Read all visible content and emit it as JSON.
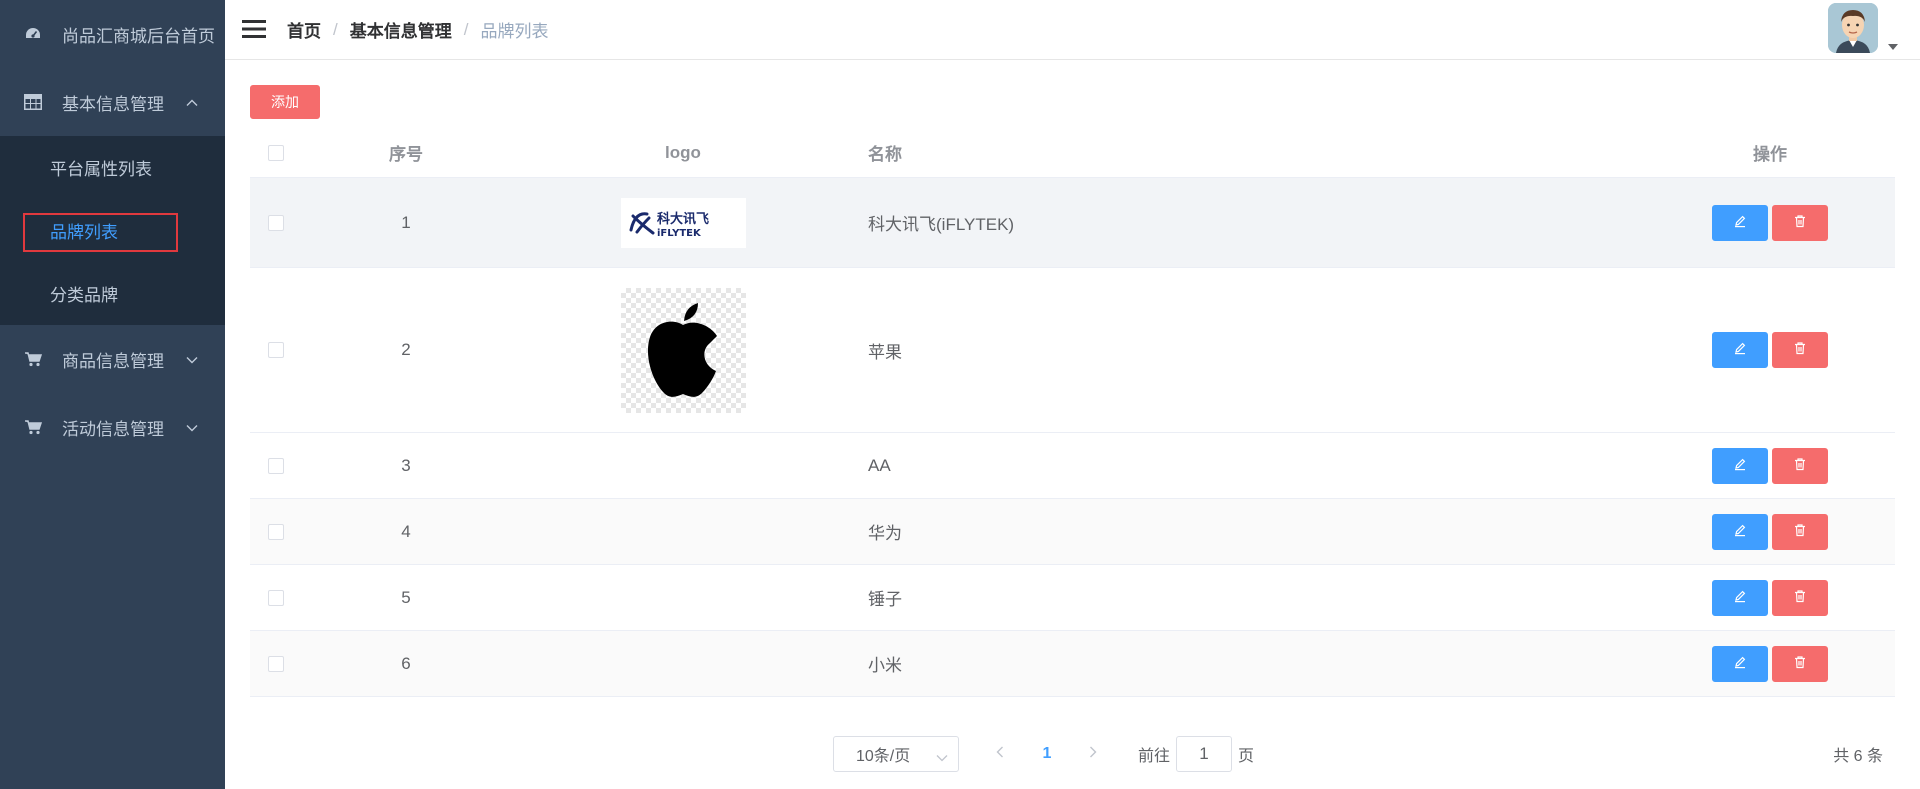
{
  "sidebar": {
    "home": "尚品汇商城后台首页",
    "groups": [
      {
        "label": "基本信息管理",
        "items": [
          "平台属性列表",
          "品牌列表",
          "分类品牌"
        ]
      },
      {
        "label": "商品信息管理"
      },
      {
        "label": "活动信息管理"
      }
    ]
  },
  "header": {
    "breadcrumb": [
      "首页",
      "基本信息管理",
      "品牌列表"
    ],
    "separator": "/"
  },
  "toolbar": {
    "add_label": "添加"
  },
  "table": {
    "columns": [
      "序号",
      "logo",
      "名称",
      "操作"
    ],
    "rows": [
      {
        "index": "1",
        "name": "科大讯飞(iFLYTEK)",
        "logo": "iflytek-logo"
      },
      {
        "index": "2",
        "name": "苹果",
        "logo": "apple-logo"
      },
      {
        "index": "3",
        "name": "AA",
        "logo": ""
      },
      {
        "index": "4",
        "name": "华为",
        "logo": ""
      },
      {
        "index": "5",
        "name": "锤子",
        "logo": ""
      },
      {
        "index": "6",
        "name": "小米",
        "logo": ""
      }
    ],
    "logo_text": {
      "iflytek_cn": "科大讯飞",
      "iflytek_en": "iFLYTEK"
    }
  },
  "pagination": {
    "page_size": "10条/页",
    "current_page": "1",
    "goto_prefix": "前往",
    "goto_value": "1",
    "goto_suffix": "页",
    "total": "共 6 条"
  },
  "colors": {
    "primary": "#409eff",
    "danger": "#f56c6c",
    "sidebar_bg": "#304156",
    "submenu_bg": "#1f2d3d",
    "highlight_box": "#e0393e"
  },
  "icons": [
    "dashboard-icon",
    "table-icon",
    "cart-icon",
    "hamburger-icon",
    "edit-icon",
    "delete-icon",
    "chevron-up-icon",
    "chevron-down-icon",
    "caret-down-icon",
    "chevron-left-icon",
    "chevron-right-icon"
  ]
}
